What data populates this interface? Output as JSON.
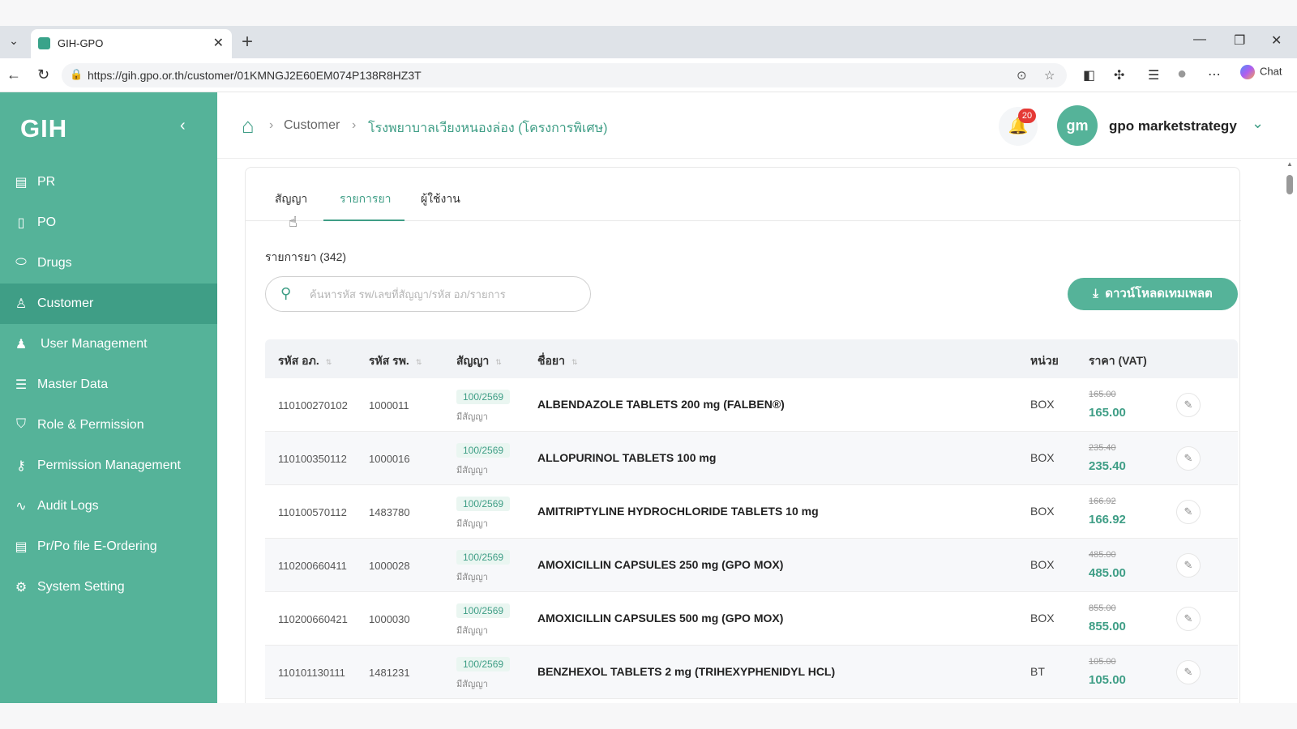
{
  "browser": {
    "tab_title": "GIH-GPO",
    "url": "https://gih.gpo.or.th/customer/01KMNGJ2E60EM074P138R8HZ3T",
    "chat_label": "Chat"
  },
  "sidebar": {
    "brand": "GIH",
    "items": [
      {
        "label": "PR",
        "icon": "document-icon"
      },
      {
        "label": "PO",
        "icon": "file-icon"
      },
      {
        "label": "Drugs",
        "icon": "pill-icon"
      },
      {
        "label": "Customer",
        "icon": "user-icon",
        "active": true
      },
      {
        "label": "User Management",
        "icon": "user-filled-icon"
      },
      {
        "label": "Master Data",
        "icon": "database-icon"
      },
      {
        "label": "Role & Permission",
        "icon": "shield-icon"
      },
      {
        "label": "Permission Management",
        "icon": "key-icon"
      },
      {
        "label": "Audit Logs",
        "icon": "activity-icon"
      },
      {
        "label": "Pr/Po file E-Ordering",
        "icon": "file-text-icon"
      },
      {
        "label": "System Setting",
        "icon": "gear-icon"
      }
    ]
  },
  "header": {
    "breadcrumb": [
      "Customer",
      "โรงพยาบาลเวียงหนองล่อง (โครงการพิเศษ)"
    ],
    "notification_count": "20",
    "avatar_initials": "gm",
    "user_name": "gpo marketstrategy"
  },
  "main": {
    "tabs": [
      "สัญญา",
      "รายการยา",
      "ผู้ใช้งาน"
    ],
    "active_tab": 1,
    "list_count": "รายการยา (342)",
    "search_placeholder": "ค้นหารหัส รพ/เลขที่สัญญา/รหัส อภ/รายการ",
    "download_label": "ดาวน์โหลดเทมเพลต",
    "columns": [
      "รหัส อภ.",
      "รหัส รพ.",
      "สัญญา",
      "ชื่อยา",
      "หน่วย",
      "ราคา (VAT)"
    ],
    "rows": [
      {
        "gpo_code": "110100270102",
        "hosp_code": "1000011",
        "contract": "100/2569",
        "contract_status": "มีสัญญา",
        "name": "ALBENDAZOLE TABLETS 200 mg (FALBEN®)",
        "unit": "BOX",
        "old_price": "165.00",
        "price": "165.00"
      },
      {
        "gpo_code": "110100350112",
        "hosp_code": "1000016",
        "contract": "100/2569",
        "contract_status": "มีสัญญา",
        "name": "ALLOPURINOL TABLETS 100 mg",
        "unit": "BOX",
        "old_price": "235.40",
        "price": "235.40"
      },
      {
        "gpo_code": "110100570112",
        "hosp_code": "1483780",
        "contract": "100/2569",
        "contract_status": "มีสัญญา",
        "name": "AMITRIPTYLINE HYDROCHLORIDE TABLETS 10 mg",
        "unit": "BOX",
        "old_price": "166.92",
        "price": "166.92"
      },
      {
        "gpo_code": "110200660411",
        "hosp_code": "1000028",
        "contract": "100/2569",
        "contract_status": "มีสัญญา",
        "name": "AMOXICILLIN CAPSULES 250 mg (GPO MOX)",
        "unit": "BOX",
        "old_price": "485.00",
        "price": "485.00"
      },
      {
        "gpo_code": "110200660421",
        "hosp_code": "1000030",
        "contract": "100/2569",
        "contract_status": "มีสัญญา",
        "name": "AMOXICILLIN CAPSULES 500 mg (GPO MOX)",
        "unit": "BOX",
        "old_price": "855.00",
        "price": "855.00"
      },
      {
        "gpo_code": "110101130111",
        "hosp_code": "1481231",
        "contract": "100/2569",
        "contract_status": "มีสัญญา",
        "name": "BENZHEXOL TABLETS 2 mg (TRIHEXYPHENIDYL HCL)",
        "unit": "BT",
        "old_price": "105.00",
        "price": "105.00"
      }
    ]
  },
  "colors": {
    "brand": "#55b399",
    "brand_dark": "#3f9e86",
    "badge": "#e53935"
  }
}
